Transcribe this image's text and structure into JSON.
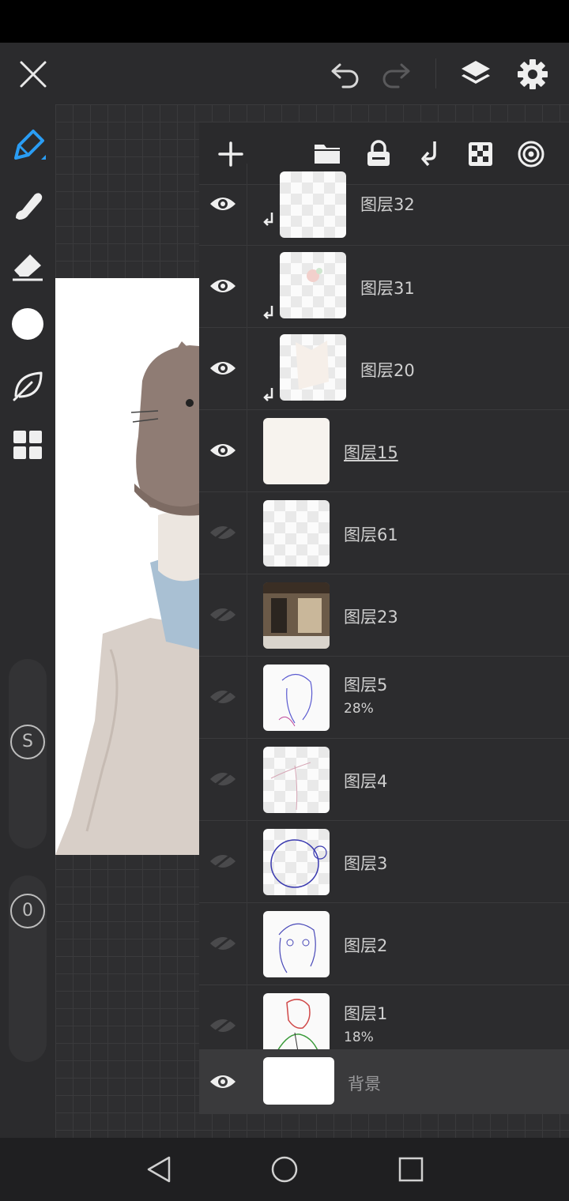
{
  "colors": {
    "accent": "#2a9df4",
    "background": "#2a2a2c",
    "panel": "#2c2c2e"
  },
  "topbar": {
    "icons": [
      "close-icon",
      "undo-icon",
      "redo-icon",
      "layers-icon",
      "settings-icon"
    ]
  },
  "toolbar": {
    "tools": [
      "pen-tool-icon",
      "smudge-tool-icon",
      "eraser-tool-icon",
      "color-swatch",
      "leaf-brush-icon",
      "grid-menu-icon"
    ],
    "size_label": "S",
    "opacity_label": "0"
  },
  "layers_panel": {
    "actions": [
      "add-layer-icon",
      "folder-icon",
      "lock-icon",
      "clip-icon",
      "transparency-icon",
      "blend-icon"
    ],
    "layers": [
      {
        "name": "图层32",
        "visible": true,
        "clipped": true,
        "opacity": ""
      },
      {
        "name": "图层31",
        "visible": true,
        "clipped": true,
        "opacity": ""
      },
      {
        "name": "图层20",
        "visible": true,
        "clipped": true,
        "opacity": ""
      },
      {
        "name": "图层15",
        "visible": true,
        "clipped": false,
        "opacity": "",
        "selected": true
      },
      {
        "name": "图层61",
        "visible": false,
        "clipped": false,
        "opacity": ""
      },
      {
        "name": "图层23",
        "visible": false,
        "clipped": false,
        "opacity": ""
      },
      {
        "name": "图层5",
        "visible": false,
        "clipped": false,
        "opacity": "28%"
      },
      {
        "name": "图层4",
        "visible": false,
        "clipped": false,
        "opacity": ""
      },
      {
        "name": "图层3",
        "visible": false,
        "clipped": false,
        "opacity": ""
      },
      {
        "name": "图层2",
        "visible": false,
        "clipped": false,
        "opacity": ""
      },
      {
        "name": "图层1",
        "visible": false,
        "clipped": false,
        "opacity": "18%"
      }
    ],
    "background_layer": {
      "name": "背景",
      "visible": true
    }
  },
  "navbar": {
    "icons": [
      "back-icon",
      "home-icon",
      "recents-icon"
    ]
  }
}
